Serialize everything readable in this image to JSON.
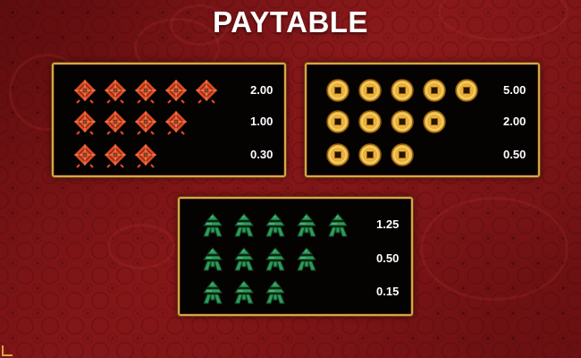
{
  "title": "PAYTABLE",
  "colors": {
    "background": "#7f1417",
    "panel": "#050202",
    "border": "#d9a44a",
    "value_text": "#ffffff",
    "knot_symbol": "#e04a25",
    "coin_symbol": "#e8b13a",
    "jade_symbol": "#2e9c58"
  },
  "panels": [
    {
      "symbol": "knot-icon",
      "rows": [
        {
          "count": 5,
          "payout": "2.00"
        },
        {
          "count": 4,
          "payout": "1.00"
        },
        {
          "count": 3,
          "payout": "0.30"
        }
      ]
    },
    {
      "symbol": "coin-icon",
      "rows": [
        {
          "count": 5,
          "payout": "5.00"
        },
        {
          "count": 4,
          "payout": "2.00"
        },
        {
          "count": 3,
          "payout": "0.50"
        }
      ]
    },
    {
      "symbol": "jade-icon",
      "rows": [
        {
          "count": 5,
          "payout": "1.25"
        },
        {
          "count": 4,
          "payout": "0.50"
        },
        {
          "count": 3,
          "payout": "0.15"
        }
      ]
    }
  ]
}
